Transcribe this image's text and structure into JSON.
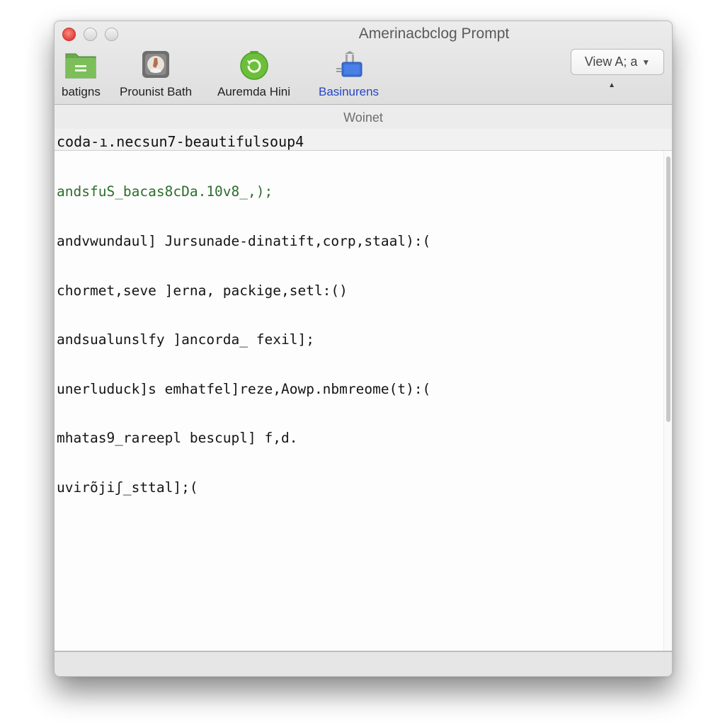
{
  "window": {
    "title": "Amerinacbclog Prompt"
  },
  "toolbar": {
    "items": [
      {
        "label": "batigns",
        "icon": "green-folder-icon"
      },
      {
        "label": "Prounist Bath",
        "icon": "app-tile-icon"
      },
      {
        "label": "Auremda Hini",
        "icon": "green-refresh-icon"
      },
      {
        "label": "Basinurens",
        "icon": "blue-network-icon",
        "active": true
      }
    ],
    "view_button_label": "View A; a",
    "view_button_caret": "▼",
    "up_caret": "▲"
  },
  "subheader": {
    "label": "Woinet"
  },
  "pathbar": {
    "text": "coda-ı.necsun7-beautifulsoup4"
  },
  "editor": {
    "lines": [
      {
        "text": "andsfuS_bacas8cDa.10v8_,);",
        "color": "green"
      },
      {
        "text": "andvwundaul] Jursunade-dinatift,corp,staal):("
      },
      {
        "text": "chormet,seve ]erna, packige,setl:()"
      },
      {
        "text": "andsualunslfy ]ancorda_ fexil];"
      },
      {
        "text": "unerluduck]s emhatfel]reze,Aowp.nbmreome(t):("
      },
      {
        "text": "mhatas9_rareepl bescupl] f,d."
      },
      {
        "text": "uvirõjiʃ_sttal];("
      }
    ]
  },
  "colors": {
    "accent_active": "#2545c4",
    "green_text": "#2c6e2c",
    "close_button": "#e0403a"
  }
}
